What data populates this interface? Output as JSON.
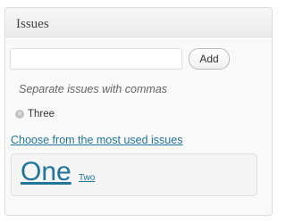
{
  "panel": {
    "title": "Issues",
    "input_value": "",
    "input_placeholder": "",
    "add_label": "Add",
    "hint": "Separate issues with commas",
    "tags": [
      {
        "label": "Three",
        "remove_icon": "close-circle-icon"
      }
    ],
    "most_used_label": "Choose from the most used issues",
    "cloud": [
      {
        "label": "One"
      },
      {
        "label": "Two"
      }
    ]
  },
  "colors": {
    "link": "#21759b",
    "header_text": "#464646",
    "border": "#dfdfdf"
  }
}
